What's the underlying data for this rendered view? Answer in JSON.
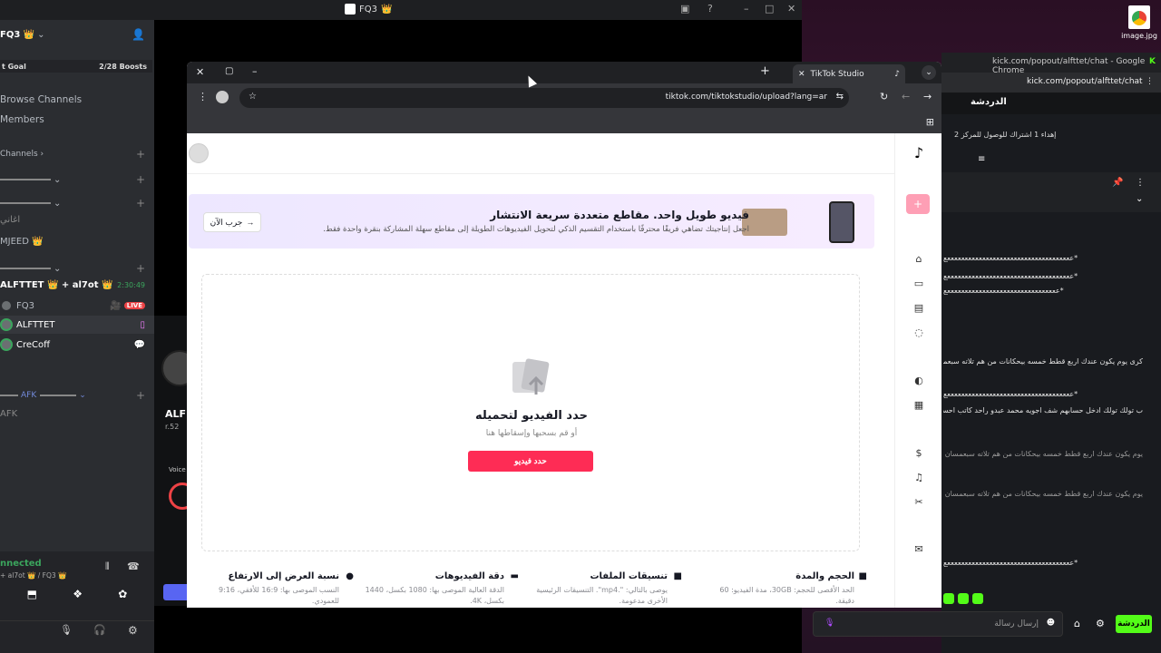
{
  "app": {
    "title": "FQ3"
  },
  "discord": {
    "server": "FQ3",
    "boost_goal_label": "t Goal",
    "boost_count": "2/28 Boosts",
    "browse_channels": "Browse Channels",
    "members": "Members",
    "channels_header": "Channels",
    "channel_agani": "اغاني",
    "user_mjeed": "MJEED",
    "voice_channel": "ALFTTET 👑 + al7ot 👑",
    "voice_timer": "2:30:49",
    "voice_users": [
      "FQ3",
      "ALFTTET",
      "CreCoff"
    ],
    "live_badge": "LIVE",
    "afk_channel": "AFK",
    "afk_item": "AFK",
    "connected": "nnected",
    "connected_sub": "+ al7ot 👑 / FQ3 👑",
    "preview_name": "ALF",
    "preview_sub": "r.52",
    "voice_label": "Voice"
  },
  "chrome": {
    "tab_title": "TikTok Studio",
    "url": "tiktok.com/tiktokstudio/upload?lang=ar"
  },
  "tiktok": {
    "banner_title": "فيديو طويل واحد. مقاطع متعددة سريعة الانتشار",
    "banner_sub": "اجعل إنتاجيتك تضاهي فريقًا محترفًا باستخدام التقسيم الذكي لتحويل الفيديوهات الطويلة إلى مقاطع سهلة المشاركة بنقرة واحدة فقط.",
    "banner_try": "جرب الآن",
    "upload_title": "حدد الفيديو لتحميله",
    "upload_sub": "أو قم بسحبها وإسقاطها هنا",
    "upload_button": "حدد فيديو",
    "features": [
      {
        "title": "الحجم والمدة",
        "desc": "الحد الأقصى للحجم: 30GB، مدة الفيديو: 60 دقيقة."
      },
      {
        "title": "تنسيقات الملفات",
        "desc": "يوصى بالتالي: \".mp4\". التنسيقات الرئيسية الأخرى مدعومة."
      },
      {
        "title": "دقة الفيديوهات",
        "desc": "الدقة العالية الموصى بها: 1080 بكسل، 1440 بكسل، 4K."
      },
      {
        "title": "نسبة العرض إلى الارتفاع",
        "desc": "النسب الموصى بها: 16:9 للأفقي، 9:16 للعمودي."
      }
    ]
  },
  "kick": {
    "tab_title": "kick.com/popout/alfttet/chat - Google Chrome",
    "address": "kick.com/popout/alfttet/chat",
    "header": "الدردشة",
    "pinned": "إهداء 1 اشتراك للوصول للمركز 2",
    "messages": [
      "*ععععععععععععععععععععععععععععععععععععع",
      "*ععععععععععععععععععععععععععععععععععععع",
      "*ععععععععععععععععععععععععععععععععع",
      "كرى يوم يكون عندك اربع قطط خمسه بيحكانات من هم تلاته سبعمسان اكيد ما",
      "*ععععععععععععععععععععععععععععععععععععع",
      "ب تولك تولك ادخل حسابهم شف اجويه محمد عبدو راحد كاتب احسب المطيل",
      "يوم يكون عندك اربع قطط خمسه بيحكانات من هم تلاته سبعمسان اكيد ما يتعرف تلك",
      "يوم يكون عندك اربع قطط خمسه بيحكانات من هم تلاته سبعمسان اكيد ما يتعرف تلك",
      "*ععععععععععععععععععععععععععععععععععععع"
    ],
    "input_placeholder": "إرسال رسالة",
    "send": "الدردشة"
  },
  "desktop": {
    "icon_label": "image.jpg"
  }
}
